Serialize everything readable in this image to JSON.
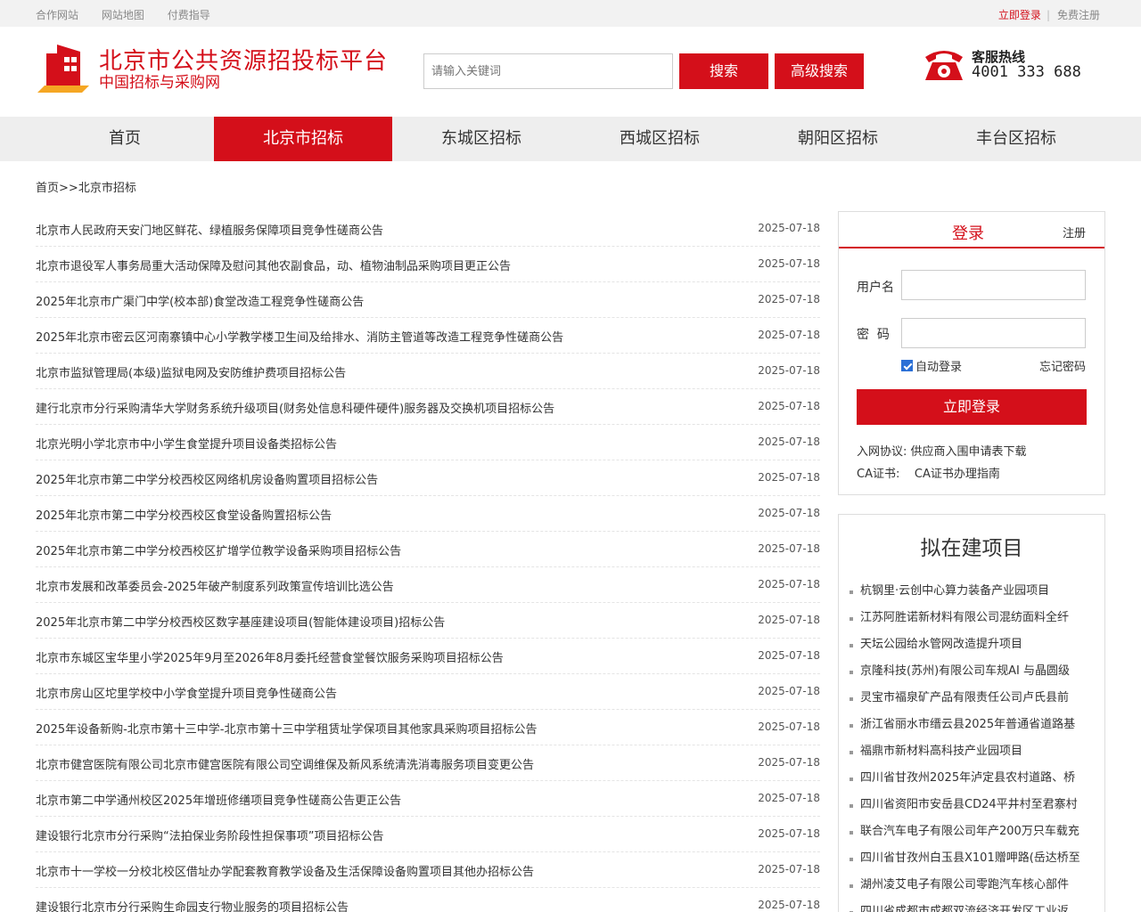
{
  "topbar": {
    "links": [
      "合作网站",
      "网站地图",
      "付费指导"
    ],
    "login": "立即登录",
    "separator": "|",
    "register": "免费注册"
  },
  "header": {
    "title": "北京市公共资源招投标平台",
    "subtitle": "中国招标与采购网",
    "search_placeholder": "请输入关键词",
    "search_button": "搜索",
    "advanced_button": "高级搜索",
    "hotline_label": "客服热线",
    "hotline_number": "4001 333 688",
    "brand_color": "#d40f1a"
  },
  "nav": {
    "items": [
      "首页",
      "北京市招标",
      "东城区招标",
      "西城区招标",
      "朝阳区招标",
      "丰台区招标"
    ],
    "active_index": 1
  },
  "breadcrumb": {
    "home": "首页",
    "separator": ">>",
    "current": "北京市招标"
  },
  "notices": [
    {
      "title": "北京市人民政府天安门地区鲜花、绿植服务保障项目竞争性磋商公告",
      "date": "2025-07-18"
    },
    {
      "title": "北京市退役军人事务局重大活动保障及慰问其他农副食品，动、植物油制品采购项目更正公告",
      "date": "2025-07-18"
    },
    {
      "title": "2025年北京市广渠门中学(校本部)食堂改造工程竞争性磋商公告",
      "date": "2025-07-18"
    },
    {
      "title": "2025年北京市密云区河南寨镇中心小学教学楼卫生间及给排水、消防主管道等改造工程竞争性磋商公告",
      "date": "2025-07-18"
    },
    {
      "title": "北京市监狱管理局(本级)监狱电网及安防维护费项目招标公告",
      "date": "2025-07-18"
    },
    {
      "title": "建行北京市分行采购清华大学财务系统升级项目(财务处信息科硬件硬件)服务器及交换机项目招标公告",
      "date": "2025-07-18"
    },
    {
      "title": "北京光明小学北京市中小学生食堂提升项目设备类招标公告",
      "date": "2025-07-18"
    },
    {
      "title": "2025年北京市第二中学分校西校区网络机房设备购置项目招标公告",
      "date": "2025-07-18"
    },
    {
      "title": "2025年北京市第二中学分校西校区食堂设备购置招标公告",
      "date": "2025-07-18"
    },
    {
      "title": "2025年北京市第二中学分校西校区扩增学位教学设备采购项目招标公告",
      "date": "2025-07-18"
    },
    {
      "title": "北京市发展和改革委员会-2025年破产制度系列政策宣传培训比选公告",
      "date": "2025-07-18"
    },
    {
      "title": "2025年北京市第二中学分校西校区数字基座建设项目(智能体建设项目)招标公告",
      "date": "2025-07-18"
    },
    {
      "title": "北京市东城区宝华里小学2025年9月至2026年8月委托经营食堂餐饮服务采购项目招标公告",
      "date": "2025-07-18"
    },
    {
      "title": "北京市房山区坨里学校中小学食堂提升项目竞争性磋商公告",
      "date": "2025-07-18"
    },
    {
      "title": "2025年设备新购-北京市第十三中学-北京市第十三中学租赁址学保项目其他家具采购项目招标公告",
      "date": "2025-07-18"
    },
    {
      "title": "北京市健宫医院有限公司北京市健宫医院有限公司空调维保及新风系统清洗消毒服务项目变更公告",
      "date": "2025-07-18"
    },
    {
      "title": "北京市第二中学通州校区2025年增班修缮项目竞争性磋商公告更正公告",
      "date": "2025-07-18"
    },
    {
      "title": "建设银行北京市分行采购“法拍保业务阶段性担保事项”项目招标公告",
      "date": "2025-07-18"
    },
    {
      "title": "北京市十一学校一分校北校区借址办学配套教育教学设备及生活保障设备购置项目其他办招标公告",
      "date": "2025-07-18"
    },
    {
      "title": "建设银行北京市分行采购生命园支行物业服务的项目招标公告",
      "date": "2025-07-18"
    }
  ],
  "login_panel": {
    "title": "登录",
    "register": "注册",
    "username_label": "用户名",
    "password_label": "密  码",
    "auto_login": "自动登录",
    "auto_login_checked": true,
    "forgot": "忘记密码",
    "submit": "立即登录",
    "agreement_label": "入网协议:",
    "agreement_link": "供应商入围申请表下载",
    "ca_label": "CA证书:",
    "ca_link": "CA证书办理指南"
  },
  "projects_panel": {
    "title": "拟在建项目",
    "items": [
      "杭钢里·云创中心算力装备产业园项目",
      "江苏阿胜诺新材料有限公司混纺面料全纤",
      "天坛公园给水管网改造提升项目",
      "京隆科技(苏州)有限公司车规AI 与晶圆级",
      "灵宝市福泉矿产品有限责任公司卢氏县前",
      "浙江省丽水市缙云县2025年普通省道路基",
      "福鼎市新材料高科技产业园项目",
      "四川省甘孜州2025年泸定县农村道路、桥",
      "四川省资阳市安岳县CD24平井村至君寨村",
      "联合汽车电子有限公司年产200万只车载充",
      "四川省甘孜州白玉县X101赠呷路(岳达桥至",
      "湖州凌艾电子有限公司零跑汽车核心部件",
      "四川省成都市成都双流经济开发区工业返"
    ]
  }
}
